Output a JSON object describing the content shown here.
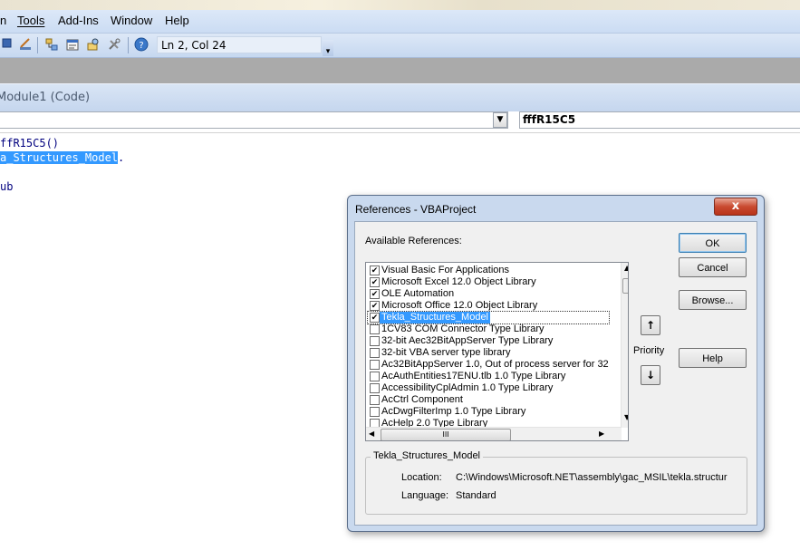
{
  "menu": {
    "partial_first": "n",
    "items": [
      "Tools",
      "Add-Ins",
      "Window",
      "Help"
    ]
  },
  "toolbar": {
    "icons": [
      "stop-icon",
      "design-mode-icon",
      "project-explorer-icon",
      "properties-icon",
      "object-browser-icon",
      "toolbox-icon",
      "help-icon"
    ],
    "cursor_position": "Ln 2, Col 24"
  },
  "code_window": {
    "title": "Module1 (Code)",
    "object_combo_value": "",
    "procedure_combo_value": "fffR15C5",
    "lines": [
      {
        "text": "ffR15C5()",
        "selected": ""
      },
      {
        "text": "",
        "selected": "a_Structures_Model",
        "after": "."
      },
      {
        "text": "",
        "selected": ""
      },
      {
        "text": "ub",
        "selected": ""
      }
    ]
  },
  "dialog": {
    "title": "References - VBAProject",
    "close_label": "x",
    "available_label": "Available References:",
    "references": [
      {
        "name": "Visual Basic For Applications",
        "checked": true,
        "selected": false
      },
      {
        "name": "Microsoft Excel 12.0 Object Library",
        "checked": true,
        "selected": false
      },
      {
        "name": "OLE Automation",
        "checked": true,
        "selected": false
      },
      {
        "name": "Microsoft Office 12.0 Object Library",
        "checked": true,
        "selected": false
      },
      {
        "name": "Tekla_Structures_Model",
        "checked": true,
        "selected": true
      },
      {
        "name": "1CV83 COM Connector Type Library",
        "checked": false,
        "selected": false
      },
      {
        "name": "32-bit Aec32BitAppServer Type Library",
        "checked": false,
        "selected": false
      },
      {
        "name": "32-bit VBA server type library",
        "checked": false,
        "selected": false
      },
      {
        "name": "Ac32BitAppServer 1.0, Out of process server for 32-",
        "checked": false,
        "selected": false
      },
      {
        "name": "AcAuthEntities17ENU.tlb 1.0 Type Library",
        "checked": false,
        "selected": false
      },
      {
        "name": "AccessibilityCplAdmin 1.0 Type Library",
        "checked": false,
        "selected": false
      },
      {
        "name": "AcCtrl Component",
        "checked": false,
        "selected": false
      },
      {
        "name": "AcDwgFilterImp 1.0 Type Library",
        "checked": false,
        "selected": false
      },
      {
        "name": "AcHelp 2.0 Type Library",
        "checked": false,
        "selected": false
      }
    ],
    "buttons": {
      "ok": "OK",
      "cancel": "Cancel",
      "browse": "Browse...",
      "help": "Help"
    },
    "priority_label": "Priority",
    "priority_up": "↑",
    "priority_down": "↓",
    "hscroll_thumb": "III",
    "details": {
      "group_title": "Tekla_Structures_Model",
      "location_label": "Location:",
      "location_value": "C:\\Windows\\Microsoft.NET\\assembly\\gac_MSIL\\tekla.structur",
      "language_label": "Language:",
      "language_value": "Standard"
    }
  }
}
